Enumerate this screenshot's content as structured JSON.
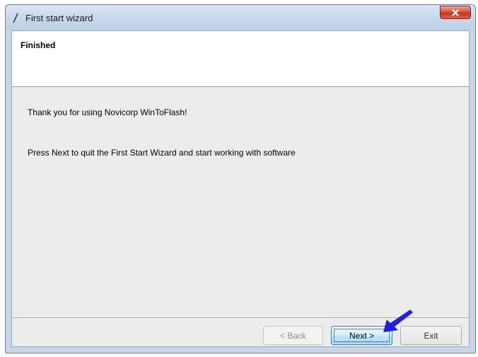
{
  "window": {
    "title": "First start wizard",
    "close_label": "x"
  },
  "header": {
    "title": "Finished"
  },
  "content": {
    "line1": "Thank you for using Novicorp WinToFlash!",
    "line2": "Press Next to quit the First Start Wizard and start working with software"
  },
  "buttons": {
    "back": "< Back",
    "next": "Next >",
    "exit": "Exit"
  },
  "colors": {
    "annotation_arrow": "#1f1fe0",
    "close_button": "#c8442a"
  }
}
